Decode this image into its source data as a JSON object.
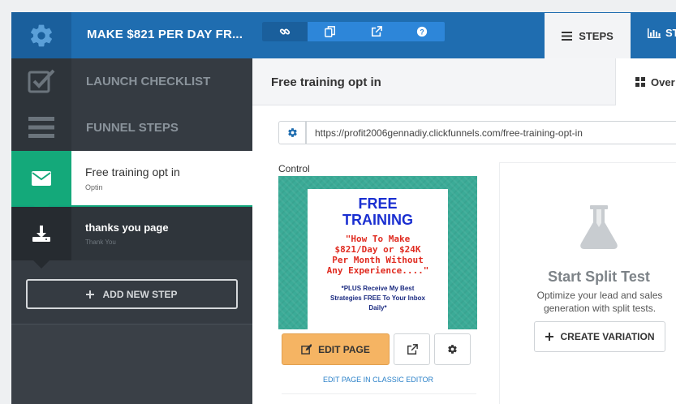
{
  "topbar": {
    "funnel_title": "MAKE $821 PER DAY FR...",
    "icons": [
      "gear-icon",
      "link-icon",
      "copy-icon",
      "external-link-icon",
      "help-icon"
    ],
    "tab_steps": "STEPS",
    "tab_stats": "ST"
  },
  "sidebar": {
    "launch_checklist": "LAUNCH CHECKLIST",
    "funnel_steps": "FUNNEL STEPS",
    "steps": [
      {
        "name": "Free training opt in",
        "type": "Optin",
        "active": true
      },
      {
        "name": "thanks you page",
        "type": "Thank You",
        "active": false
      }
    ],
    "add_step": "ADD NEW STEP"
  },
  "main": {
    "title": "Free training opt in",
    "overview_tab": "Over",
    "url": "https://profit2006gennadiy.clickfunnels.com/free-training-opt-in",
    "control_label": "Control",
    "preview": {
      "heading_line1": "FREE",
      "heading_line2": "TRAINING",
      "quote_line1": "\"How To Make",
      "quote_line2": "$821/Day or $24K",
      "quote_line3": "Per Month Without",
      "quote_line4": "Any Experience....\"",
      "bonus_line1": "*PLUS Receive My Best",
      "bonus_line2": "Strategies FREE To Your Inbox",
      "bonus_line3": "Daily*"
    },
    "edit_page": "EDIT PAGE",
    "classic_editor_link": "EDIT PAGE IN CLASSIC EDITOR",
    "split_test": {
      "title": "Start Split Test",
      "subtitle": "Optimize your lead and sales generation with split tests.",
      "create_variation": "CREATE VARIATION"
    }
  },
  "colors": {
    "topbar": "#1f6db0",
    "active_step": "#14a97a",
    "edit_button": "#f5b463",
    "sidebar": "#353b42"
  }
}
